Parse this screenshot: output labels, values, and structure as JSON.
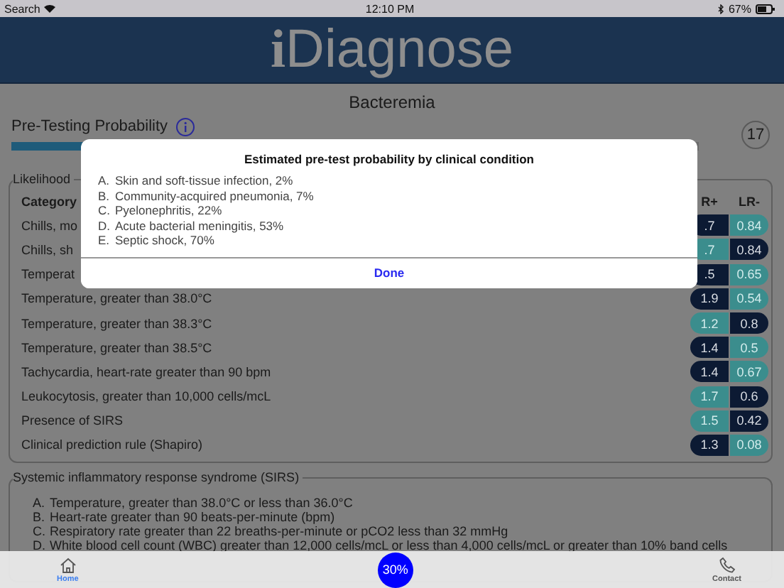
{
  "status_bar": {
    "back": "Search",
    "time": "12:10 PM",
    "battery": "67%"
  },
  "header": {
    "logo_i": "i",
    "logo_rest": "Diagnose"
  },
  "page_title": "Bacteremia",
  "pretest": {
    "label": "Pre-Testing Probability",
    "level": 0.3,
    "count": "17"
  },
  "likelihood": {
    "legend": "Likelihood",
    "columns": [
      "Category",
      "R+",
      "LR-"
    ],
    "rows": [
      {
        "label": "Chills, mo",
        "lr_plus": {
          "value": ".7",
          "selected": true
        },
        "lr_minus": {
          "value": "0.84",
          "selected": false
        }
      },
      {
        "label": "Chills, sh",
        "lr_plus": {
          "value": ".7",
          "selected": false
        },
        "lr_minus": {
          "value": "0.84",
          "selected": true
        }
      },
      {
        "label": "Temperat",
        "lr_plus": {
          "value": ".5",
          "selected": true
        },
        "lr_minus": {
          "value": "0.65",
          "selected": false
        }
      },
      {
        "label": "Temperature, greater than 38.0°C",
        "lr_plus": {
          "value": "1.9",
          "selected": true
        },
        "lr_minus": {
          "value": "0.54",
          "selected": false
        }
      },
      {
        "label": "Temperature, greater than 38.3°C",
        "lr_plus": {
          "value": "1.2",
          "selected": false
        },
        "lr_minus": {
          "value": "0.8",
          "selected": true
        }
      },
      {
        "label": "Temperature, greater than 38.5°C",
        "lr_plus": {
          "value": "1.4",
          "selected": true
        },
        "lr_minus": {
          "value": "0.5",
          "selected": false
        }
      },
      {
        "label": "Tachycardia, heart-rate greater than 90 bpm",
        "lr_plus": {
          "value": "1.4",
          "selected": true
        },
        "lr_minus": {
          "value": "0.67",
          "selected": false
        }
      },
      {
        "label": "Leukocytosis, greater than 10,000 cells/mcL",
        "lr_plus": {
          "value": "1.7",
          "selected": false
        },
        "lr_minus": {
          "value": "0.6",
          "selected": true
        }
      },
      {
        "label": "Presence of SIRS",
        "lr_plus": {
          "value": "1.5",
          "selected": false
        },
        "lr_minus": {
          "value": "0.42",
          "selected": true
        }
      },
      {
        "label": "Clinical prediction rule (Shapiro)",
        "lr_plus": {
          "value": "1.3",
          "selected": true
        },
        "lr_minus": {
          "value": "0.08",
          "selected": false
        }
      }
    ]
  },
  "sirs": {
    "legend": "Systemic inflammatory response syndrome (SIRS)",
    "items": [
      {
        "letter": "A.",
        "text": "Temperature, greater than 38.0°C or less than 36.0°C"
      },
      {
        "letter": "B.",
        "text": "Heart-rate greater than 90 beats-per-minute (bpm)"
      },
      {
        "letter": "C.",
        "text": "Respiratory rate greater than 22 breaths-per-minute or pCO2 less than 32 mmHg"
      },
      {
        "letter": "D.",
        "text": "White blood cell count (WBC) greater than 12,000 cells/mcL or less than 4,000 cells/mcL or greater than 10% band cells"
      }
    ]
  },
  "dialog": {
    "title": "Estimated pre-test probability by clinical condition",
    "items": [
      {
        "letter": "A.",
        "text": "Skin and soft-tissue infection, 2%"
      },
      {
        "letter": "B.",
        "text": "Community-acquired pneumonia, 7%"
      },
      {
        "letter": "C.",
        "text": "Pyelonephritis, 22%"
      },
      {
        "letter": "D.",
        "text": "Acute bacterial meningitis, 53%"
      },
      {
        "letter": "E.",
        "text": "Septic shock, 70%"
      }
    ],
    "button": "Done"
  },
  "tab_bar": {
    "tabs": [
      {
        "label": "Home",
        "kind": "home",
        "selected": true
      },
      {
        "label": "Contact",
        "kind": "contact",
        "selected": false
      }
    ],
    "center": "30%"
  }
}
